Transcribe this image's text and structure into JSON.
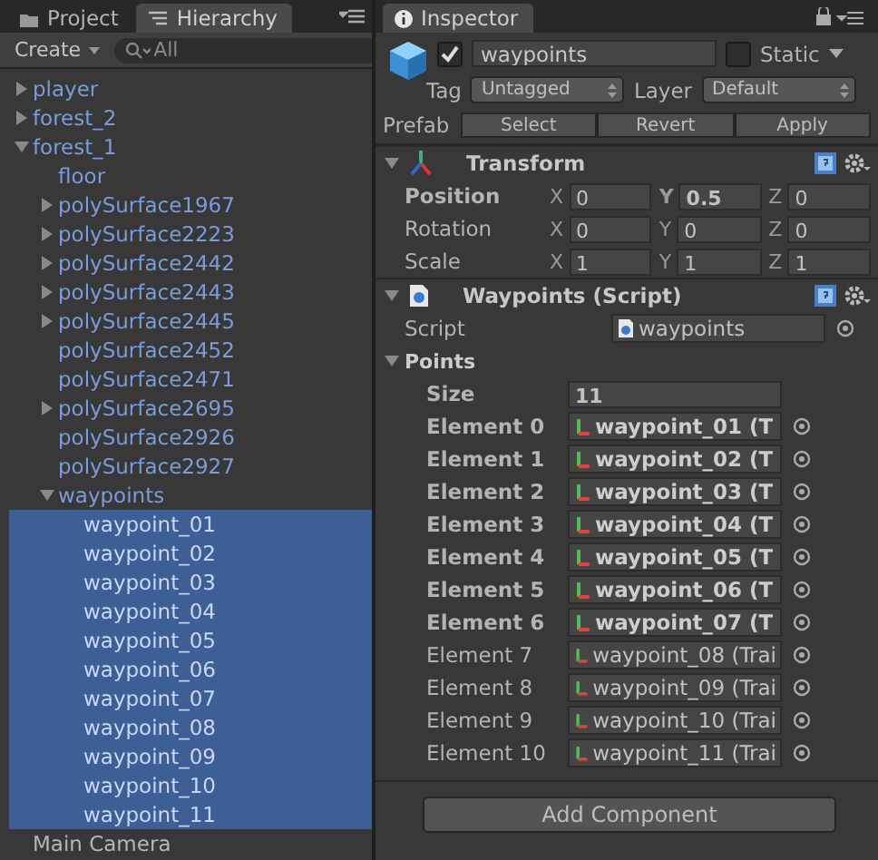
{
  "hierarchy_panel": {
    "tabs": [
      {
        "label": "Project",
        "kind": "project",
        "selected": false
      },
      {
        "label": "Hierarchy",
        "kind": "hierarchy",
        "selected": true
      }
    ],
    "create_button": "Create",
    "search": {
      "placeholder": "All"
    },
    "tree": [
      {
        "label": "player",
        "kind": "node",
        "expanded": false,
        "prefab": true,
        "selected": false
      },
      {
        "label": "forest_2",
        "kind": "node",
        "expanded": false,
        "prefab": true,
        "selected": false
      },
      {
        "label": "forest_1",
        "kind": "node",
        "expanded": true,
        "prefab": true,
        "selected": false,
        "children": [
          {
            "label": "floor",
            "kind": "leaf",
            "prefab": true,
            "selected": false
          },
          {
            "label": "polySurface1967",
            "kind": "node",
            "expanded": false,
            "prefab": true,
            "selected": false
          },
          {
            "label": "polySurface2223",
            "kind": "node",
            "expanded": false,
            "prefab": true,
            "selected": false
          },
          {
            "label": "polySurface2442",
            "kind": "node",
            "expanded": false,
            "prefab": true,
            "selected": false
          },
          {
            "label": "polySurface2443",
            "kind": "node",
            "expanded": false,
            "prefab": true,
            "selected": false
          },
          {
            "label": "polySurface2445",
            "kind": "node",
            "expanded": false,
            "prefab": true,
            "selected": false
          },
          {
            "label": "polySurface2452",
            "kind": "leaf",
            "prefab": true,
            "selected": false
          },
          {
            "label": "polySurface2471",
            "kind": "leaf",
            "prefab": true,
            "selected": false
          },
          {
            "label": "polySurface2695",
            "kind": "node",
            "expanded": false,
            "prefab": true,
            "selected": false
          },
          {
            "label": "polySurface2926",
            "kind": "leaf",
            "prefab": true,
            "selected": false
          },
          {
            "label": "polySurface2927",
            "kind": "leaf",
            "prefab": true,
            "selected": false
          },
          {
            "label": "waypoints",
            "kind": "node",
            "expanded": true,
            "prefab": true,
            "selected": false,
            "children": [
              {
                "label": "waypoint_01",
                "kind": "leaf",
                "prefab": true,
                "selected": true
              },
              {
                "label": "waypoint_02",
                "kind": "leaf",
                "prefab": true,
                "selected": true
              },
              {
                "label": "waypoint_03",
                "kind": "leaf",
                "prefab": true,
                "selected": true
              },
              {
                "label": "waypoint_04",
                "kind": "leaf",
                "prefab": true,
                "selected": true
              },
              {
                "label": "waypoint_05",
                "kind": "leaf",
                "prefab": true,
                "selected": true
              },
              {
                "label": "waypoint_06",
                "kind": "leaf",
                "prefab": true,
                "selected": true
              },
              {
                "label": "waypoint_07",
                "kind": "leaf",
                "prefab": true,
                "selected": true
              },
              {
                "label": "waypoint_08",
                "kind": "leaf",
                "prefab": true,
                "selected": true
              },
              {
                "label": "waypoint_09",
                "kind": "leaf",
                "prefab": true,
                "selected": true
              },
              {
                "label": "waypoint_10",
                "kind": "leaf",
                "prefab": true,
                "selected": true
              },
              {
                "label": "waypoint_11",
                "kind": "leaf",
                "prefab": true,
                "selected": true
              }
            ]
          }
        ]
      },
      {
        "label": "Main Camera",
        "kind": "leaf",
        "prefab": false,
        "selected": false
      }
    ]
  },
  "inspector": {
    "tab": "Inspector",
    "object": {
      "active": true,
      "name": "waypoints",
      "static_label": "Static",
      "static": false,
      "tag_label": "Tag",
      "tag": "Untagged",
      "layer_label": "Layer",
      "layer": "Default",
      "prefab_label": "Prefab",
      "prefab_buttons": [
        "Select",
        "Revert",
        "Apply"
      ]
    },
    "components": [
      {
        "kind": "transform",
        "title": "Transform",
        "expanded": true,
        "rows": [
          {
            "label": "Position",
            "modified": true,
            "fields": [
              {
                "axis": "X",
                "value": "0",
                "modified": false
              },
              {
                "axis": "Y",
                "value": "0.5",
                "modified": true
              },
              {
                "axis": "Z",
                "value": "0",
                "modified": false
              }
            ]
          },
          {
            "label": "Rotation",
            "modified": false,
            "fields": [
              {
                "axis": "X",
                "value": "0",
                "modified": false
              },
              {
                "axis": "Y",
                "value": "0",
                "modified": false
              },
              {
                "axis": "Z",
                "value": "0",
                "modified": false
              }
            ]
          },
          {
            "label": "Scale",
            "modified": false,
            "fields": [
              {
                "axis": "X",
                "value": "1",
                "modified": false
              },
              {
                "axis": "Y",
                "value": "1",
                "modified": false
              },
              {
                "axis": "Z",
                "value": "1",
                "modified": false
              }
            ]
          }
        ]
      },
      {
        "kind": "script",
        "title": "Waypoints (Script)",
        "expanded": true,
        "script_label": "Script",
        "script_value": "waypoints",
        "array": {
          "label": "Points",
          "expanded": true,
          "size_label": "Size",
          "size": "11",
          "elements": [
            {
              "label": "Element 0",
              "value": "waypoint_01 (T",
              "modified": true
            },
            {
              "label": "Element 1",
              "value": "waypoint_02 (T",
              "modified": true
            },
            {
              "label": "Element 2",
              "value": "waypoint_03 (T",
              "modified": true
            },
            {
              "label": "Element 3",
              "value": "waypoint_04 (T",
              "modified": true
            },
            {
              "label": "Element 4",
              "value": "waypoint_05 (T",
              "modified": true
            },
            {
              "label": "Element 5",
              "value": "waypoint_06 (T",
              "modified": true
            },
            {
              "label": "Element 6",
              "value": "waypoint_07 (T",
              "modified": true
            },
            {
              "label": "Element 7",
              "value": "waypoint_08 (Trai",
              "modified": false
            },
            {
              "label": "Element 8",
              "value": "waypoint_09 (Trai",
              "modified": false
            },
            {
              "label": "Element 9",
              "value": "waypoint_10 (Trai",
              "modified": false
            },
            {
              "label": "Element 10",
              "value": "waypoint_11 (Trai",
              "modified": false
            }
          ]
        }
      }
    ],
    "add_component": "Add Component"
  }
}
